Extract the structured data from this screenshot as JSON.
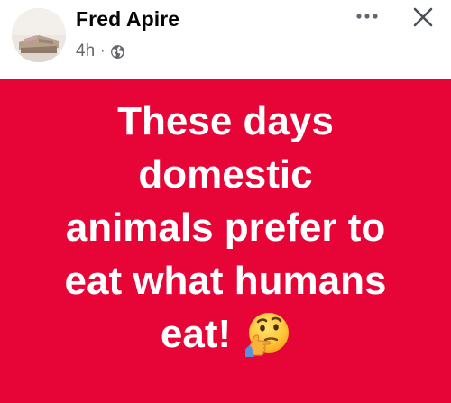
{
  "post": {
    "author": "Fred Apire",
    "time": "4h",
    "separator": "·",
    "privacy_icon": "globe-icon",
    "more_icon": "more-horizontal-icon",
    "close_icon": "close-icon"
  },
  "text_post": {
    "background_color": "#e60536",
    "lines": [
      "These days",
      "domestic",
      "animals prefer to",
      "eat what humans",
      "eat!"
    ],
    "emoji_icon": "thinking-face-icon"
  }
}
